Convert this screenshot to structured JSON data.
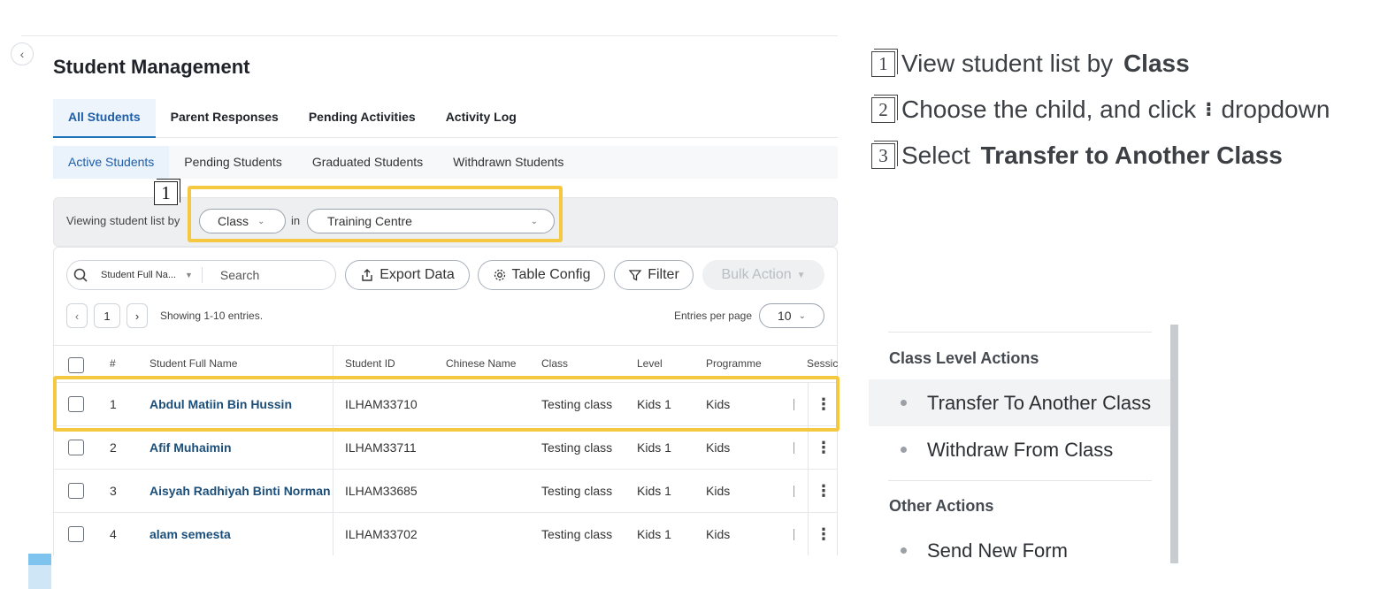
{
  "header": {
    "title": "Student Management"
  },
  "tabs": [
    "All Students",
    "Parent Responses",
    "Pending Activities",
    "Activity Log"
  ],
  "subtabs": [
    "Active Students",
    "Pending Students",
    "Graduated Students",
    "Withdrawn Students"
  ],
  "viewbar": {
    "label": "Viewing student list by",
    "group_by": "Class",
    "in_label": "in",
    "location": "Training Centre"
  },
  "toolbar": {
    "search_field": "Student Full Na...",
    "search_placeholder": "Search",
    "export": "Export Data",
    "table_config": "Table Config",
    "filter": "Filter",
    "bulk_action": "Bulk Action"
  },
  "pagination": {
    "page": "1",
    "info": "Showing 1-10 entries.",
    "entries_label": "Entries per page",
    "entries_value": "10"
  },
  "columns": [
    "#",
    "Student Full Name",
    "Student ID",
    "Chinese Name",
    "Class",
    "Level",
    "Programme",
    "Sessic"
  ],
  "rows": [
    {
      "num": "1",
      "name": "Abdul Matiin Bin Hussin",
      "id": "ILHAM33710",
      "chinese": "",
      "class": "Testing class",
      "level": "Kids 1",
      "programme": "Kids"
    },
    {
      "num": "2",
      "name": "Afif Muhaimin",
      "id": "ILHAM33711",
      "chinese": "",
      "class": "Testing class",
      "level": "Kids 1",
      "programme": "Kids"
    },
    {
      "num": "3",
      "name": "Aisyah Radhiyah Binti Norman",
      "id": "ILHAM33685",
      "chinese": "",
      "class": "Testing class",
      "level": "Kids 1",
      "programme": "Kids"
    },
    {
      "num": "4",
      "name": "alam semesta",
      "id": "ILHAM33702",
      "chinese": "",
      "class": "Testing class",
      "level": "Kids 1",
      "programme": "Kids"
    }
  ],
  "markers": {
    "one": "1",
    "two": "2",
    "three": "3"
  },
  "instructions": [
    {
      "num": "1",
      "text": "View student list by ",
      "bold": "Class"
    },
    {
      "num": "2",
      "text": "Choose the child, and click",
      "glyph": "⁝",
      "text2": "dropdown"
    },
    {
      "num": "3",
      "text": "Select ",
      "bold": "Transfer to Another Class"
    }
  ],
  "menu": {
    "group1": "Class Level Actions",
    "item1": "Transfer To Another Class",
    "item2": "Withdraw From Class",
    "group2": "Other Actions",
    "item3": "Send New Form"
  },
  "colors": {
    "highlight": "#f5c842",
    "link": "#1b4f7a",
    "active_tab": "#1f5ea8"
  },
  "icons": [
    "search-icon",
    "export-icon",
    "gear-icon",
    "filter-icon",
    "chevron-down-icon",
    "chevron-left-icon",
    "chevron-right-icon",
    "kebab-icon"
  ]
}
